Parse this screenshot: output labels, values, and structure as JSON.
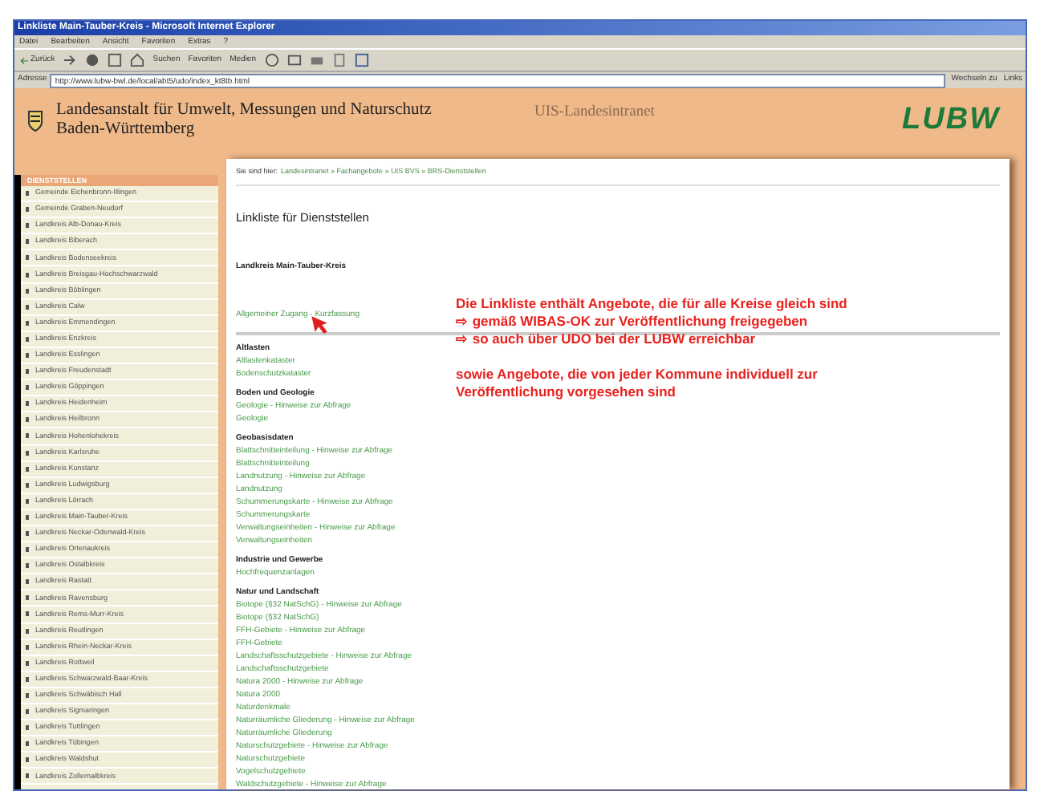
{
  "window": {
    "title": "Linkliste Main-Tauber-Kreis - Microsoft Internet Explorer"
  },
  "menu": [
    "Datei",
    "Bearbeiten",
    "Ansicht",
    "Favoriten",
    "Extras",
    "?"
  ],
  "toolbar": {
    "back": "Zurück",
    "search": "Suchen",
    "favorites": "Favoriten",
    "media": "Medien"
  },
  "address_bar": {
    "label": "Adresse",
    "value": "http://www.lubw-bwl.de/local/abt5/udo/index_kt8tb.html",
    "go": "Wechseln zu",
    "links": "Links"
  },
  "header": {
    "title_line_1": "Landesanstalt für Umwelt, Messungen und Naturschutz",
    "title_line_2": "Baden-Württemberg",
    "intranet": "UIS-Landesintranet",
    "logo": "LUBW"
  },
  "sidebar": {
    "heading": "DIENSTSTELLEN",
    "items": [
      "Gemeinde Eichenbronn-Illingen",
      "Gemeinde Graben-Neudorf",
      "Landkreis Alb-Donau-Kreis",
      "Landkreis Biberach",
      "Landkreis Bodenseekreis",
      "Landkreis Breisgau-Hochschwarzwald",
      "Landkreis Böblingen",
      "Landkreis Calw",
      "Landkreis Emmendingen",
      "Landkreis Enzkreis",
      "Landkreis Esslingen",
      "Landkreis Freudenstadt",
      "Landkreis Göppingen",
      "Landkreis Heidenheim",
      "Landkreis Heilbronn",
      "Landkreis Hohenlohekreis",
      "Landkreis Karlsruhe",
      "Landkreis Konstanz",
      "Landkreis Ludwigsburg",
      "Landkreis Lörrach",
      "Landkreis Main-Tauber-Kreis",
      "Landkreis Neckar-Odenwald-Kreis",
      "Landkreis Ortenaukreis",
      "Landkreis Ostalbkreis",
      "Landkreis Rastatt",
      "Landkreis Ravensburg",
      "Landkreis Rems-Murr-Kreis",
      "Landkreis Reutlingen",
      "Landkreis Rhein-Neckar-Kreis",
      "Landkreis Rottweil",
      "Landkreis Schwarzwald-Baar-Kreis",
      "Landkreis Schwäbisch Hall",
      "Landkreis Sigmaringen",
      "Landkreis Tuttlingen",
      "Landkreis Tübingen",
      "Landkreis Waldshut",
      "Landkreis Zollernalbkreis"
    ]
  },
  "breadcrumb": {
    "label": "Sie sind hier:",
    "path": "Landesintranet » Fachangebote » UIS BVS » BRS-Dienststellen"
  },
  "page_title": "Linkliste für Dienststellen",
  "district": "Landkreis Main-Tauber-Kreis",
  "general_link": "Allgemeiner Zugang - Kurzfassung",
  "sections": [
    {
      "title": "Altlasten",
      "links": [
        "Altlastenkataster",
        "Bodenschutzkataster"
      ]
    },
    {
      "title": "Boden und Geologie",
      "links": [
        "Geologie - Hinweise zur Abfrage",
        "Geologie"
      ]
    },
    {
      "title": "Geobasisdaten",
      "links": [
        "Blattschnitteinteilung - Hinweise zur Abfrage",
        "Blattschnitteinteilung",
        "Landnutzung - Hinweise zur Abfrage",
        "Landnutzung",
        "Schummerungskarte - Hinweise zur Abfrage",
        "Schummerungskarte",
        "Verwaltungseinheiten - Hinweise zur Abfrage",
        "Verwaltungseinheiten"
      ]
    },
    {
      "title": "Industrie und Gewerbe",
      "links": [
        "Hochfrequenzanlagen"
      ]
    },
    {
      "title": "Natur und Landschaft",
      "links": [
        "Biotope (§32 NatSchG) - Hinweise zur Abfrage",
        "Biotope (§32 NatSchG)",
        "FFH-Gebiete - Hinweise zur Abfrage",
        "FFH-Gebiete",
        "Landschaftsschutzgebiete - Hinweise zur Abfrage",
        "Landschaftsschutzgebiete",
        "Natura 2000 - Hinweise zur Abfrage",
        "Natura 2000",
        "Naturdenkmale",
        "Naturräumliche Gliederung - Hinweise zur Abfrage",
        "Naturräumliche Gliederung",
        "Naturschutzgebiete - Hinweise zur Abfrage",
        "Naturschutzgebiete",
        "Vogelschutzgebiete",
        "Waldschutzgebiete - Hinweise zur Abfrage"
      ]
    }
  ],
  "annotation": {
    "lines": [
      "Die Linkliste enthält Angebote, die für alle Kreise gleich sind",
      "⇨ gemäß WIBAS-OK zur Veröffentlichung freigegeben",
      "⇨ so auch über UDO bei der LUBW erreichbar"
    ],
    "note": "sowie Angebote, die von jeder Kommune individuell zur Veröffentlichung vorgesehen sind"
  }
}
